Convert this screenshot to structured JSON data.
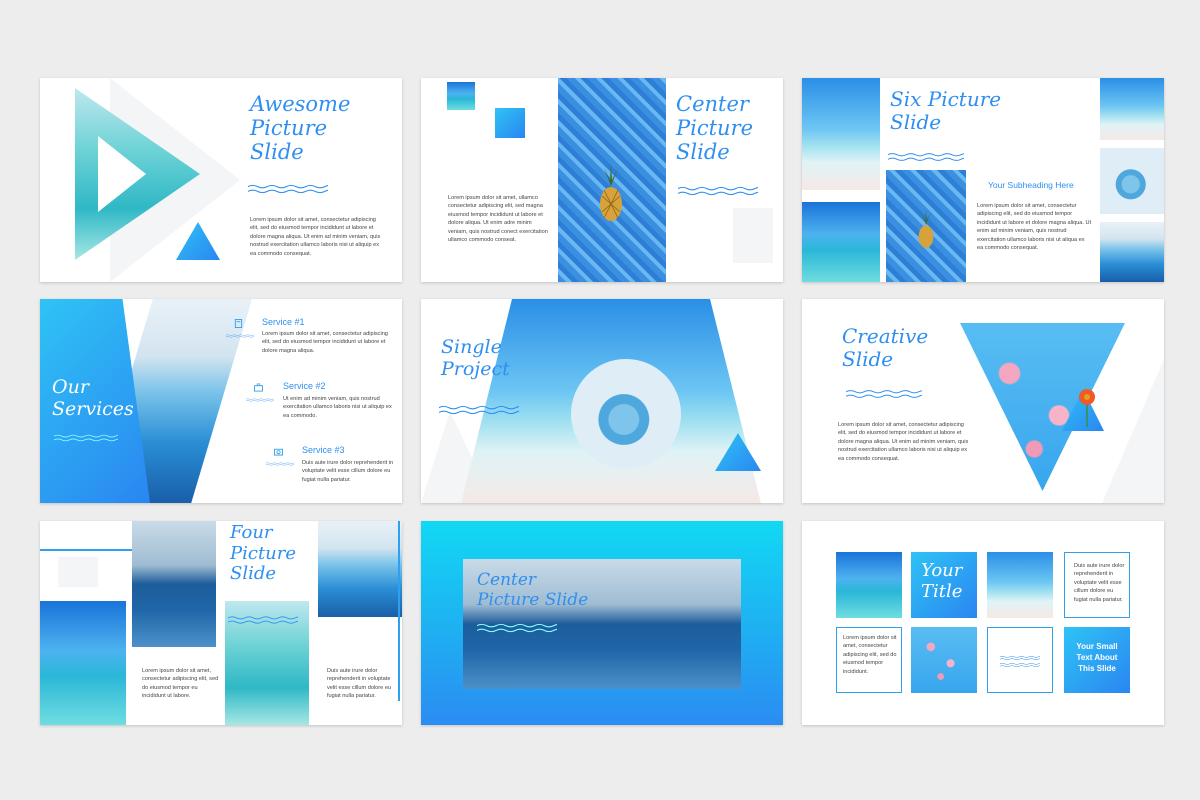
{
  "slides": {
    "s1": {
      "title_lines": [
        "Awesome",
        "Picture",
        "Slide"
      ],
      "body": "Lorem ipsum dolor sit amet, consectetur adipiscing elit, sed do eiusmod tempor incididunt ut labore et dolore magna aliqua. Ut enim ad minim veniam, quis nostrud exercitation ullamco laboris nisi ut aliquip ex ea commodo consequat."
    },
    "s2": {
      "title_lines": [
        "Center",
        "Picture",
        "Slide"
      ],
      "body": "Lorem ipsum dolor sit amet, ullamco consectetur adipiscing elit, sed magna eiusmod tempor incididunt ut labore et dolore aliqua. Ut enim adre minim veniam, quis nostrud conect exercitation ullamco commodo conseat."
    },
    "s3": {
      "title_lines": [
        "Six Picture",
        "Slide"
      ],
      "subheading": "Your Subheading Here",
      "body": "Lorem ipsum dolor sit amet, consectetur adipiscing elit, sed do eiusmod tempor incididunt ut labore et dolore magna aliqua. Ut enim ad minim veniam, quis nostrud exercitation ullamco laboris nisi ut aliqua ex ea commodo consequat."
    },
    "s4": {
      "title_lines": [
        "Our",
        "Services"
      ],
      "services": [
        {
          "label": "Service #1",
          "body": "Lorem ipsum dolor sit amet, consectetur adipiscing elit, sed do eiusmod tempor incididunt ut labore et dolore magna aliqua."
        },
        {
          "label": "Service #2",
          "body": "Ut enim ad minim veniam, quis nostrud exercitation ullamco laboris nisi ut aliquip ex ea commodo."
        },
        {
          "label": "Service #3",
          "body": "Duis aute irure dolor reprehenderit in voluptate velit esse cillum dolore eu fugiat nulla pariatur."
        }
      ]
    },
    "s5": {
      "title_lines": [
        "Single",
        "Project"
      ]
    },
    "s6": {
      "title_lines": [
        "Creative",
        "Slide"
      ],
      "body": "Lorem ipsum dolor sit amet, consectetur adipiscing elit, sed do eiusmod tempor incididunt ut labore et dolore magna aliqua. Ut enim ad minim veniam, quis nostrud exercitation ullamco laboris nisi ut aliquip ex ea commodo consequat."
    },
    "s7": {
      "title_lines": [
        "Four",
        "Picture",
        "Slide"
      ],
      "body_left": "Lorem ipsum dolor sit amet, consectetur adipiscing elit, sed do eiusmod tempor eu incididunt ut labore.",
      "body_right": "Duis aute irure dolor reprehenderit in voluptate velit esse cillum dolore eu fugiat nulla pariatur."
    },
    "s8": {
      "title_lines": [
        "Center",
        "Picture Slide"
      ]
    },
    "s9": {
      "title_lines": [
        "Your",
        "Title"
      ],
      "text_top": "Duis aute irure dolor reprehenderit in voluptate velit esse cillum dolore eu fugiat nulla pariatur.",
      "text_left": "Lorem ipsum dolor sit amet, consectetur adipiscing elit, sed do eiusmod tempor incididunt.",
      "cta_lines": [
        "Your Small",
        "Text About",
        "This Slide"
      ]
    }
  },
  "colors": {
    "accent": "#2f8ff0",
    "gradient_start": "#11d9f3",
    "gradient_end": "#2b8cf2",
    "background": "#ededed"
  },
  "icons": [
    "book-icon",
    "suitcase-icon",
    "camera-icon"
  ]
}
